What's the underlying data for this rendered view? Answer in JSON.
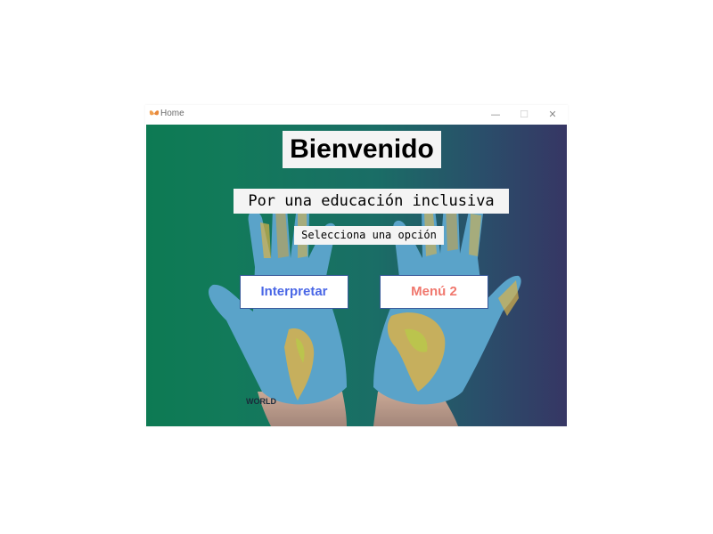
{
  "window": {
    "title": "Home",
    "icon": "butterfly-icon",
    "controls": {
      "minimize": "—",
      "maximize": "☐",
      "close": "✕"
    }
  },
  "main": {
    "heading": "Bienvenido",
    "subtitle": "Por una educación inclusiva",
    "prompt": "Selecciona una opción",
    "buttons": {
      "interpretar": "Interpretar",
      "menu2": "Menú 2"
    }
  },
  "background": {
    "image": "hands-world-map",
    "label": "WORLD"
  },
  "colors": {
    "bg_left": "#0d7a53",
    "bg_right": "#363664",
    "hands": "#5aa3c9",
    "button_interpretar_text": "#4a67e6",
    "button_menu2_text": "#f0786e",
    "button_border": "#3a5a9a",
    "heading_bg": "#f4f4f4"
  }
}
